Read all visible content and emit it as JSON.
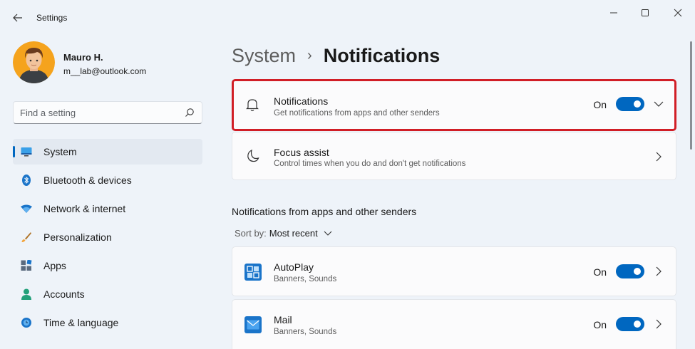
{
  "window": {
    "title": "Settings",
    "controls": [
      "minimize-icon",
      "maximize-icon",
      "close-icon"
    ]
  },
  "profile": {
    "name": "Mauro H.",
    "email": "m__lab@outlook.com"
  },
  "search": {
    "placeholder": "Find a setting"
  },
  "sidebar": {
    "items": [
      {
        "label": "System",
        "icon": "monitor-icon",
        "selected": true
      },
      {
        "label": "Bluetooth & devices",
        "icon": "bluetooth-icon",
        "selected": false
      },
      {
        "label": "Network & internet",
        "icon": "wifi-icon",
        "selected": false
      },
      {
        "label": "Personalization",
        "icon": "brush-icon",
        "selected": false
      },
      {
        "label": "Apps",
        "icon": "apps-icon",
        "selected": false
      },
      {
        "label": "Accounts",
        "icon": "person-icon",
        "selected": false
      },
      {
        "label": "Time & language",
        "icon": "globe-clock-icon",
        "selected": false
      }
    ]
  },
  "breadcrumb": {
    "parent": "System",
    "separator": "›",
    "current": "Notifications"
  },
  "notifications_card": {
    "title": "Notifications",
    "subtitle": "Get notifications from apps and other senders",
    "state": "On",
    "icon": "bell-icon"
  },
  "focus_card": {
    "title": "Focus assist",
    "subtitle": "Control times when you do and don't get notifications",
    "icon": "moon-icon"
  },
  "apps_section": {
    "title": "Notifications from apps and other senders",
    "sort_label": "Sort by:",
    "sort_value": "Most recent",
    "apps": [
      {
        "name": "AutoPlay",
        "detail": "Banners, Sounds",
        "state": "On",
        "icon": "autoplay-icon"
      },
      {
        "name": "Mail",
        "detail": "Banners, Sounds",
        "state": "On",
        "icon": "mail-icon"
      }
    ]
  },
  "colors": {
    "accent": "#0067c0",
    "highlight_border": "#d11e26",
    "background": "#eef3f9"
  }
}
